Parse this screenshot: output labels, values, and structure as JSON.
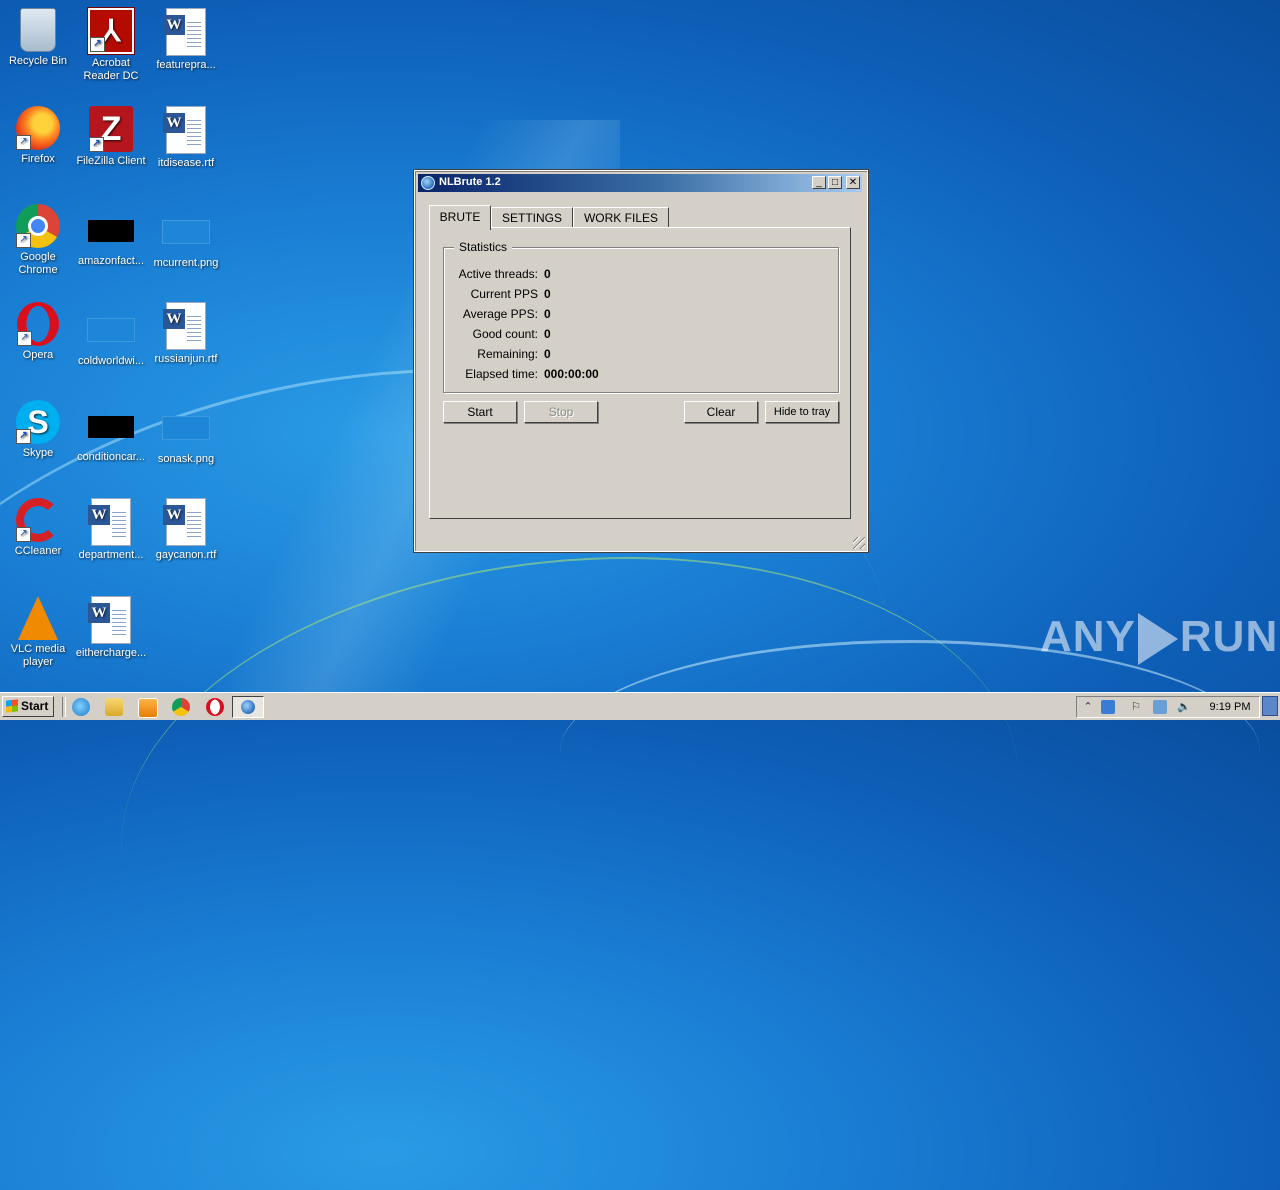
{
  "desktop": {
    "icons": [
      {
        "label": "Recycle Bin",
        "icon": "recycle-bin-icon"
      },
      {
        "label": "Acrobat Reader DC",
        "icon": "acrobat-icon"
      },
      {
        "label": "featurepra...",
        "icon": "word-doc-icon"
      },
      {
        "label": "Firefox",
        "icon": "firefox-icon"
      },
      {
        "label": "FileZilla Client",
        "icon": "filezilla-icon"
      },
      {
        "label": "itdisease.rtf",
        "icon": "word-doc-icon"
      },
      {
        "label": "Google Chrome",
        "icon": "chrome-icon"
      },
      {
        "label": "amazonfact...",
        "icon": "image-file-icon"
      },
      {
        "label": "mcurrent.png",
        "icon": "image-file-icon"
      },
      {
        "label": "Opera",
        "icon": "opera-icon"
      },
      {
        "label": "coldworldwi...",
        "icon": "image-file-icon"
      },
      {
        "label": "russianjun.rtf",
        "icon": "word-doc-icon"
      },
      {
        "label": "Skype",
        "icon": "skype-icon"
      },
      {
        "label": "conditioncar...",
        "icon": "image-file-icon"
      },
      {
        "label": "sonask.png",
        "icon": "image-file-icon"
      },
      {
        "label": "CCleaner",
        "icon": "ccleaner-icon"
      },
      {
        "label": "department...",
        "icon": "word-doc-icon"
      },
      {
        "label": "gaycanon.rtf",
        "icon": "word-doc-icon"
      },
      {
        "label": "VLC media player",
        "icon": "vlc-icon"
      },
      {
        "label": "eithercharge...",
        "icon": "word-doc-icon"
      }
    ]
  },
  "window": {
    "title": "NLBrute 1.2",
    "controls": {
      "minimize": "_",
      "maximize": "□",
      "close": "✕"
    },
    "tabs": [
      {
        "label": "BRUTE",
        "active": true
      },
      {
        "label": "SETTINGS",
        "active": false
      },
      {
        "label": "WORK FILES",
        "active": false
      }
    ],
    "statistics": {
      "legend": "Statistics",
      "rows": [
        {
          "label": "Active threads:",
          "value": "0"
        },
        {
          "label": "Current PPS",
          "value": "0"
        },
        {
          "label": "Average PPS:",
          "value": "0"
        },
        {
          "label": "Good count:",
          "value": "0"
        },
        {
          "label": "Remaining:",
          "value": "0"
        },
        {
          "label": "Elapsed time:",
          "value": "000:00:00"
        }
      ]
    },
    "buttons": {
      "start": "Start",
      "stop": "Stop",
      "clear": "Clear",
      "hide": "Hide to tray"
    }
  },
  "watermark": {
    "left": "ANY",
    "right": "RUN"
  },
  "taskbar": {
    "start_label": "Start",
    "quicklaunch": [
      "ie-icon",
      "explorer-icon",
      "media-player-icon",
      "chrome-icon",
      "opera-icon"
    ],
    "clock": "9:19 PM",
    "tray_icons": [
      "show-hidden-icon",
      "network-icon",
      "flag-icon",
      "monitor-icon",
      "volume-icon"
    ]
  },
  "colors": {
    "desktop_bg": "#1a7fd4",
    "titlebar_start": "#0a246a",
    "titlebar_end": "#a6caf0",
    "window_face": "#d4d0c8"
  }
}
